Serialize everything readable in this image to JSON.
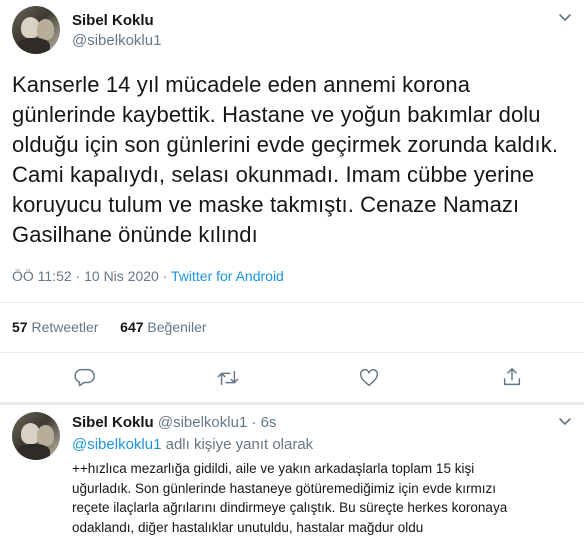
{
  "tweet": {
    "author_name": "Sibel Koklu",
    "handle": "@sibelkoklu1",
    "text_lines": [
      "Kanserle 14 yıl mücadele eden annemi korona",
      "günlerinde kaybettik. Hastane ve yoğun bakımlar dolu",
      "olduğu için son günlerini evde geçirmek zorunda kaldık.",
      "Cami kapalıydı, selası okunmadı. Imam cübbe yerine",
      "koruyucu tulum ve maske takmıştı. Cenaze  Namazı",
      "Gasilhane önünde kılındı"
    ],
    "time": "ÖÖ 11:52 · 10 Nis 2020 · ",
    "source": "Twitter for Android",
    "retweets_count": "57",
    "retweets_label": "Retweetler",
    "likes_count": "647",
    "likes_label": "Beğeniler"
  },
  "actions": {
    "reply_icon": "reply-icon",
    "retweet_icon": "retweet-icon",
    "like_icon": "heart-icon",
    "share_icon": "share-icon"
  },
  "reply": {
    "author_name": "Sibel Koklu",
    "handle_time": "@sibelkoklu1 · 6s",
    "replying_to_handle": "@sibelkoklu1",
    "replying_to_label": " adlı kişiye yanıt olarak",
    "text_lines": [
      "++hızlıca mezarlığa gidildi, aile ve yakın arkadaşlarla toplam 15 kişi",
      "uğurladık. Son günlerinde hastaneye götüremediğimiz için evde kırmızı",
      "reçete ilaçlarla ağrılarını dindirmeye çalıştık. Bu süreçte herkes koronaya",
      "odaklandı, diğer hastalıklar unutuldu, hastalar mağdur oldu"
    ]
  },
  "colors": {
    "accent": "#1b95e0",
    "text": "#14171a",
    "secondary": "#657786",
    "divider": "#e6ecf0"
  }
}
